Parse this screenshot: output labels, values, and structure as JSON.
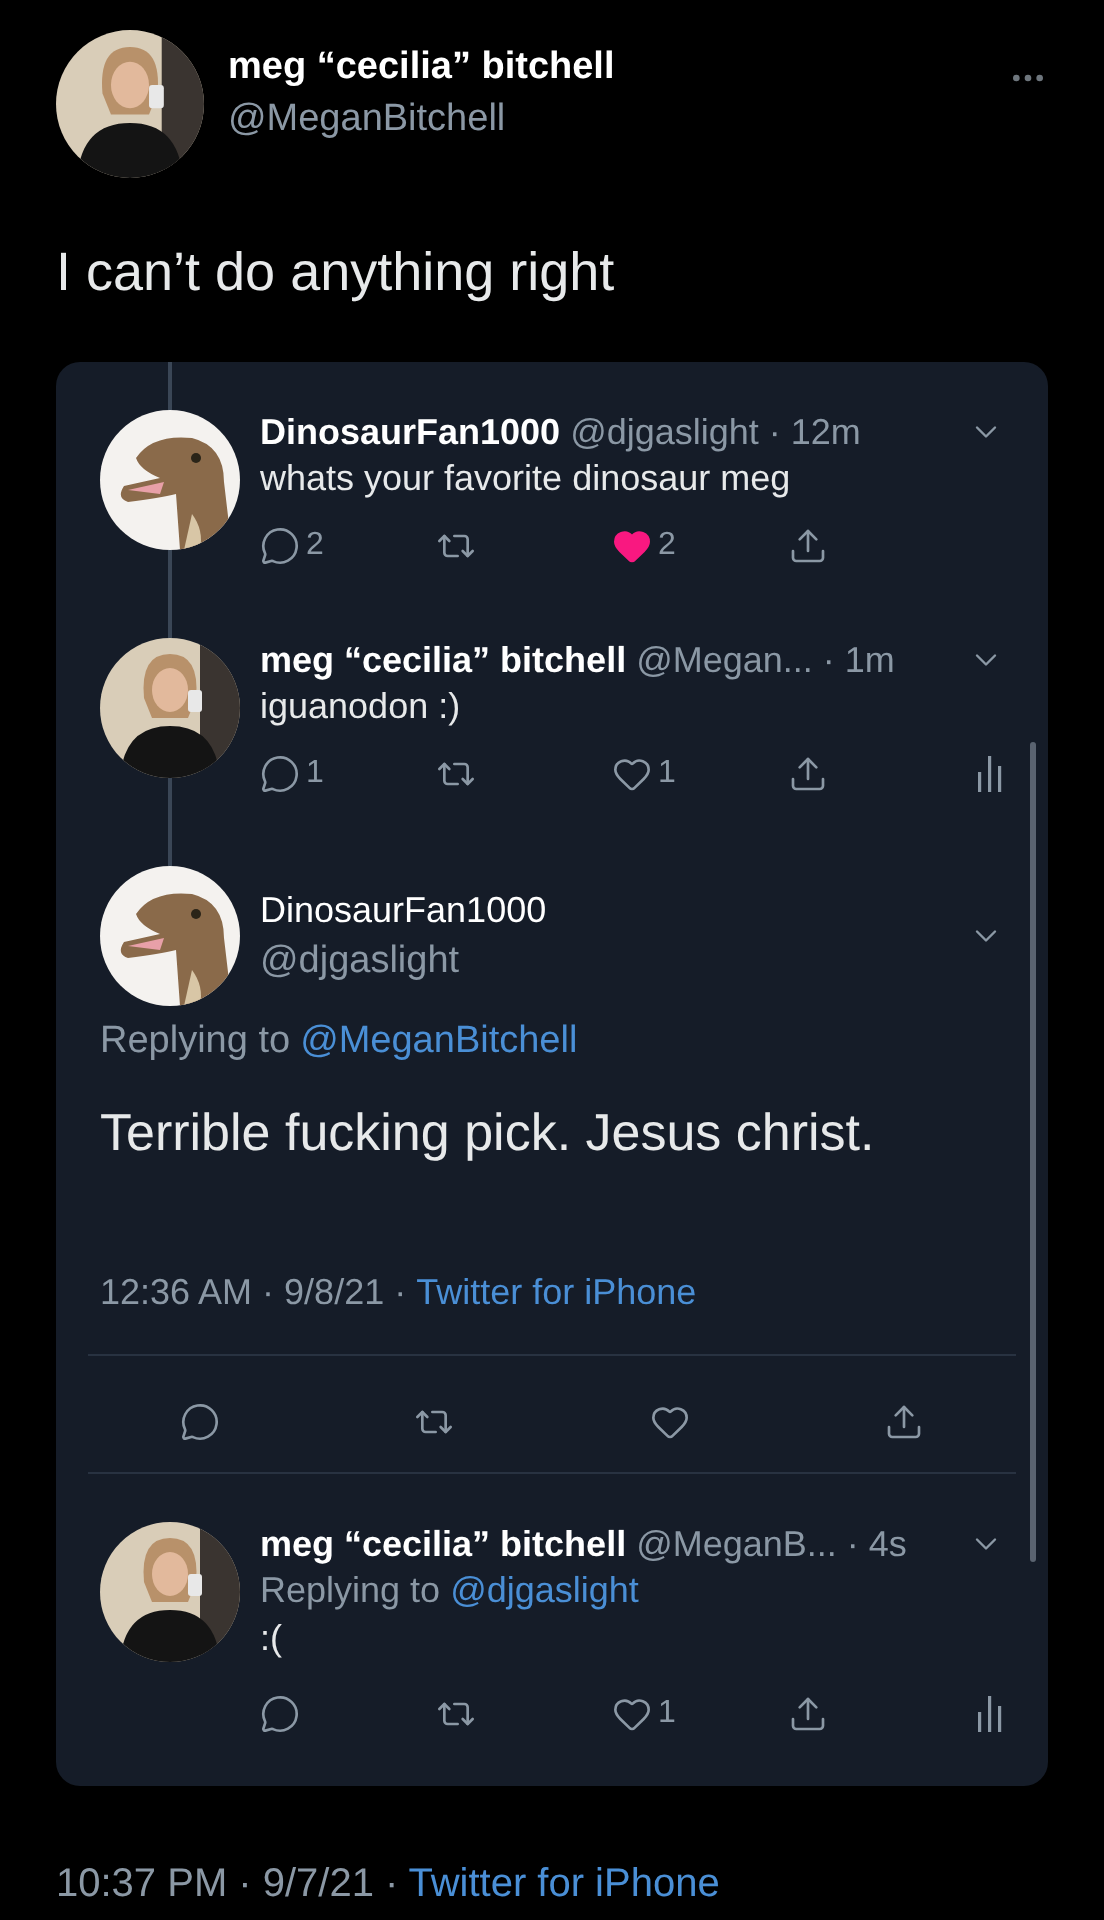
{
  "author": {
    "name": "meg “cecilia” bitchell",
    "handle": "@MeganBitchell",
    "avatar": {
      "kind": "person"
    }
  },
  "text": "I can’t do anything right",
  "thread": {
    "items": [
      {
        "kind": "reply",
        "avatar": {
          "kind": "dinosaur"
        },
        "connected_above": true,
        "name": "DinosaurFan1000",
        "handle": "@djgaslight",
        "time": "· 12m",
        "text": "whats your favorite dinosaur meg",
        "actions": [
          {
            "kind": "reply",
            "count": "2"
          },
          {
            "kind": "retweet"
          },
          {
            "kind": "like",
            "count": "2",
            "on": true
          },
          {
            "kind": "share"
          }
        ]
      },
      {
        "kind": "reply",
        "avatar": {
          "kind": "person"
        },
        "connected_above": true,
        "name": "meg “cecilia” bitchell",
        "handle": "@Megan...",
        "time": " · 1m",
        "text": "iguanodon :)",
        "actions": [
          {
            "kind": "reply",
            "count": "1"
          },
          {
            "kind": "retweet"
          },
          {
            "kind": "like",
            "count": "1",
            "on": false
          },
          {
            "kind": "share"
          },
          {
            "kind": "analytics"
          }
        ]
      },
      {
        "kind": "focused",
        "avatar": {
          "kind": "dinosaur"
        },
        "connected_above": true,
        "name": "DinosaurFan1000",
        "handle": "@djgaslight",
        "replying_label": "Replying to",
        "replying_to": "@MeganBitchell",
        "text": "Terrible fucking pick. Jesus christ.",
        "time": "12:36 AM · 9/8/21 ·",
        "source": "Twitter for iPhone",
        "actions": [
          {
            "kind": "reply"
          },
          {
            "kind": "retweet"
          },
          {
            "kind": "like",
            "on": false
          },
          {
            "kind": "share"
          }
        ]
      },
      {
        "kind": "reply",
        "avatar": {
          "kind": "person"
        },
        "connected_above": false,
        "name": "meg “cecilia” bitchell",
        "handle": "@MeganB...",
        "time": "· 4s",
        "replying_label": "Replying to",
        "replying_to": "@djgaslight",
        "text": ":(",
        "actions": [
          {
            "kind": "reply"
          },
          {
            "kind": "retweet"
          },
          {
            "kind": "like",
            "count": "1",
            "on": false
          },
          {
            "kind": "share"
          },
          {
            "kind": "analytics"
          }
        ]
      }
    ]
  },
  "meta": {
    "time": "10:37 PM · 9/7/21 ·",
    "source": "Twitter for iPhone"
  }
}
